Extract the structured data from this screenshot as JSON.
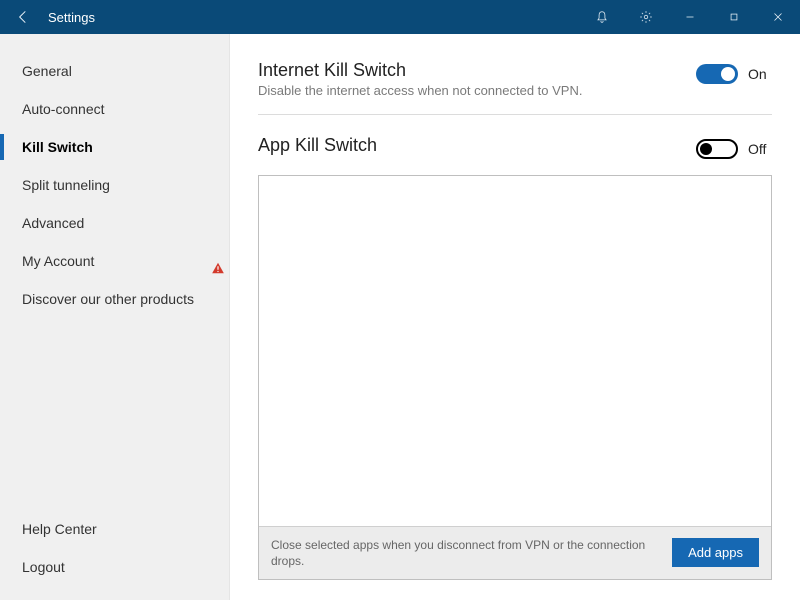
{
  "titlebar": {
    "title": "Settings"
  },
  "sidebar": {
    "items": [
      {
        "label": "General"
      },
      {
        "label": "Auto-connect"
      },
      {
        "label": "Kill Switch",
        "selected": true
      },
      {
        "label": "Split tunneling"
      },
      {
        "label": "Advanced"
      },
      {
        "label": "My Account",
        "warn": true
      },
      {
        "label": "Discover our other products"
      }
    ],
    "bottom": [
      {
        "label": "Help Center"
      },
      {
        "label": "Logout"
      }
    ]
  },
  "main": {
    "internet_kill_switch": {
      "title": "Internet Kill Switch",
      "desc": "Disable the internet access when not connected to VPN.",
      "state_label": "On"
    },
    "app_kill_switch": {
      "title": "App Kill Switch",
      "state_label": "Off",
      "footer_text": "Close selected apps when you disconnect from VPN or the connection drops.",
      "add_button": "Add apps"
    }
  }
}
